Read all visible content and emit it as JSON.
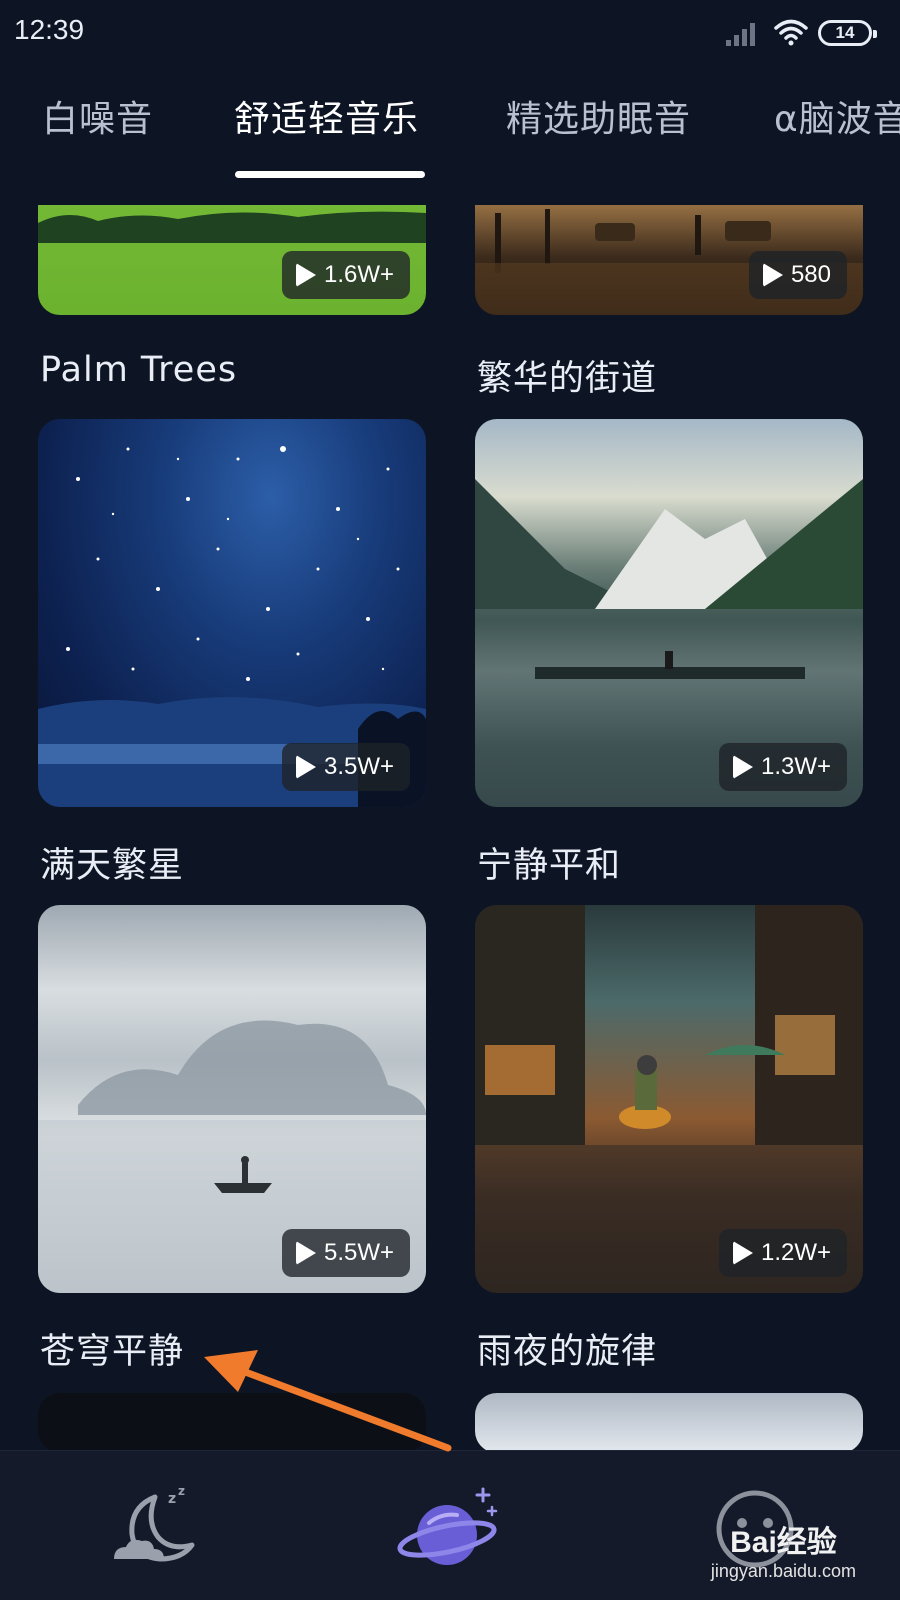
{
  "status_bar": {
    "time": "12:39",
    "battery": "14",
    "icons": [
      "signal-icon",
      "wifi-icon",
      "battery-icon"
    ]
  },
  "tabs": [
    {
      "label": "白噪音",
      "active": false
    },
    {
      "label": "舒适轻音乐",
      "active": true
    },
    {
      "label": "精选助眠音",
      "active": false
    },
    {
      "label": "α脑波音",
      "active": false
    }
  ],
  "cards": [
    {
      "title": "Palm Trees",
      "plays": "1.6W+"
    },
    {
      "title": "繁华的街道",
      "plays": "580"
    },
    {
      "title": "满天繁星",
      "plays": "3.5W+"
    },
    {
      "title": "宁静平和",
      "plays": "1.3W+"
    },
    {
      "title": "苍穹平静",
      "plays": "5.5W+"
    },
    {
      "title": "雨夜的旋律",
      "plays": "1.2W+"
    }
  ],
  "bottom_nav": {
    "items": [
      "sleep-moon-icon",
      "planet-icon",
      "profile-icon"
    ],
    "active_index": 1
  },
  "watermark": {
    "logo": "Bai经验",
    "url": "jingyan.baidu.com"
  },
  "colors": {
    "background": "#0d1424",
    "accent": "#7b6fe0",
    "arrow": "#f07b2d"
  }
}
